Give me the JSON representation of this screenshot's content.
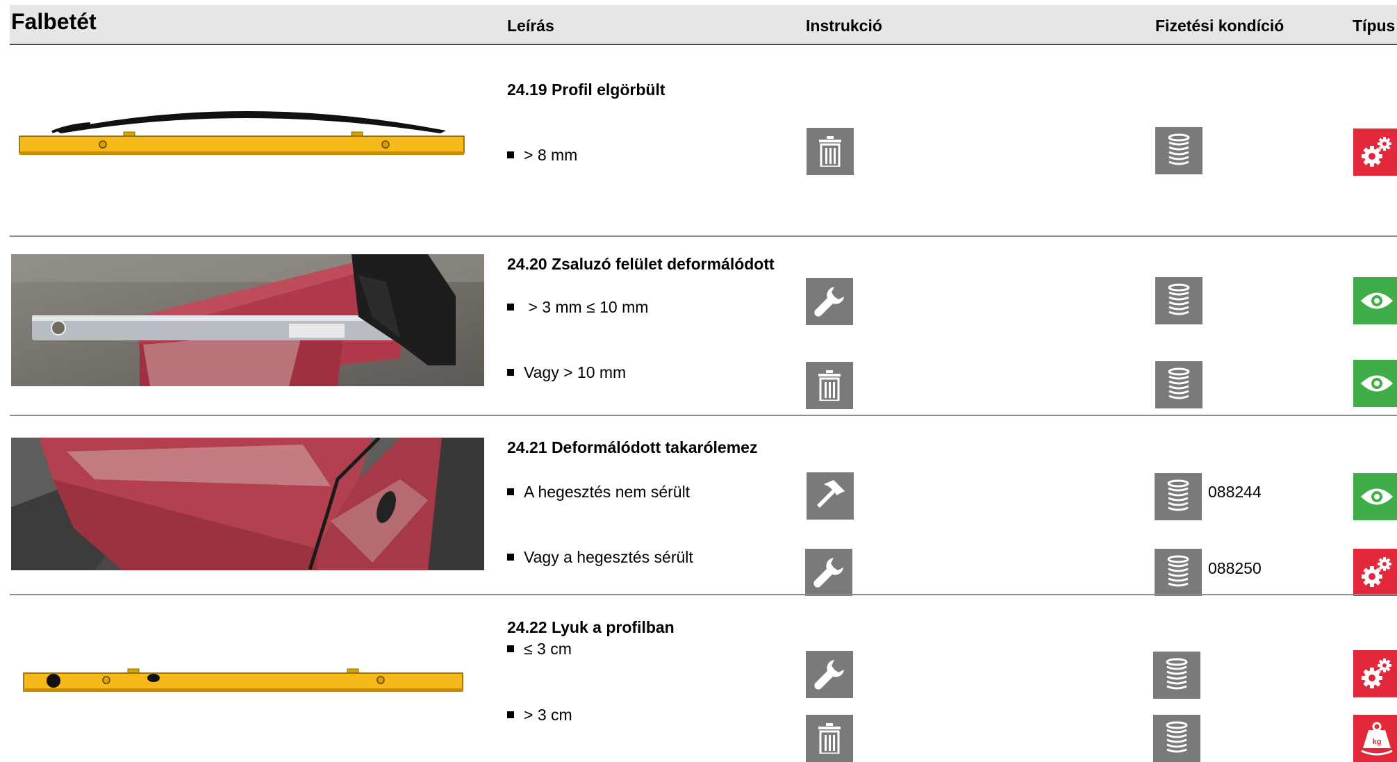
{
  "header": {
    "title": "Falbetét",
    "col_description": "Leírás",
    "col_instruction": "Instrukció",
    "col_payment": "Fizetési kondíció",
    "col_type": "Típus"
  },
  "sections": [
    {
      "title": "24.19 Profil elgörbült",
      "rows": [
        {
          "text": "> 8 mm",
          "instruction_icon": "trash-icon",
          "payment_icon": "coin-stack-icon",
          "code": "",
          "type_icon": "gears-icon",
          "type_color": "#e3283b"
        }
      ]
    },
    {
      "title": "24.20 Zsaluzó felület deformálódott",
      "rows": [
        {
          "text": " > 3 mm ≤ 10 mm",
          "instruction_icon": "wrench-icon",
          "payment_icon": "coin-stack-icon",
          "code": "",
          "type_icon": "eye-icon",
          "type_color": "#3fae49"
        },
        {
          "text": "Vagy > 10 mm",
          "instruction_icon": "trash-icon",
          "payment_icon": "coin-stack-icon",
          "code": "",
          "type_icon": "eye-icon",
          "type_color": "#3fae49"
        }
      ]
    },
    {
      "title": "24.21 Deformálódott takarólemez",
      "rows": [
        {
          "text": "A hegesztés nem sérült",
          "instruction_icon": "hammer-icon",
          "payment_icon": "coin-stack-icon",
          "code": "088244",
          "type_icon": "eye-icon",
          "type_color": "#3fae49"
        },
        {
          "text": "Vagy a hegesztés sérült",
          "instruction_icon": "wrench-icon",
          "payment_icon": "coin-stack-icon",
          "code": "088250",
          "type_icon": "gears-icon",
          "type_color": "#e3283b"
        }
      ]
    },
    {
      "title": "24.22 Lyuk a profilban",
      "rows": [
        {
          "text": "≤ 3 cm",
          "instruction_icon": "wrench-icon",
          "payment_icon": "coin-stack-icon",
          "code": "",
          "type_icon": "gears-icon",
          "type_color": "#e3283b"
        },
        {
          "text": "> 3 cm",
          "instruction_icon": "trash-icon",
          "payment_icon": "coin-stack-icon",
          "code": "",
          "type_icon": "weight-kg-icon",
          "type_color": "#e3283b"
        }
      ]
    }
  ],
  "images": {
    "img1": "bent-profile-drawing",
    "img2": "deformed-formwork-photo",
    "img3": "deformed-cover-plate-photo",
    "img4": "profile-with-holes-drawing"
  },
  "icon_weight_label": "kg"
}
